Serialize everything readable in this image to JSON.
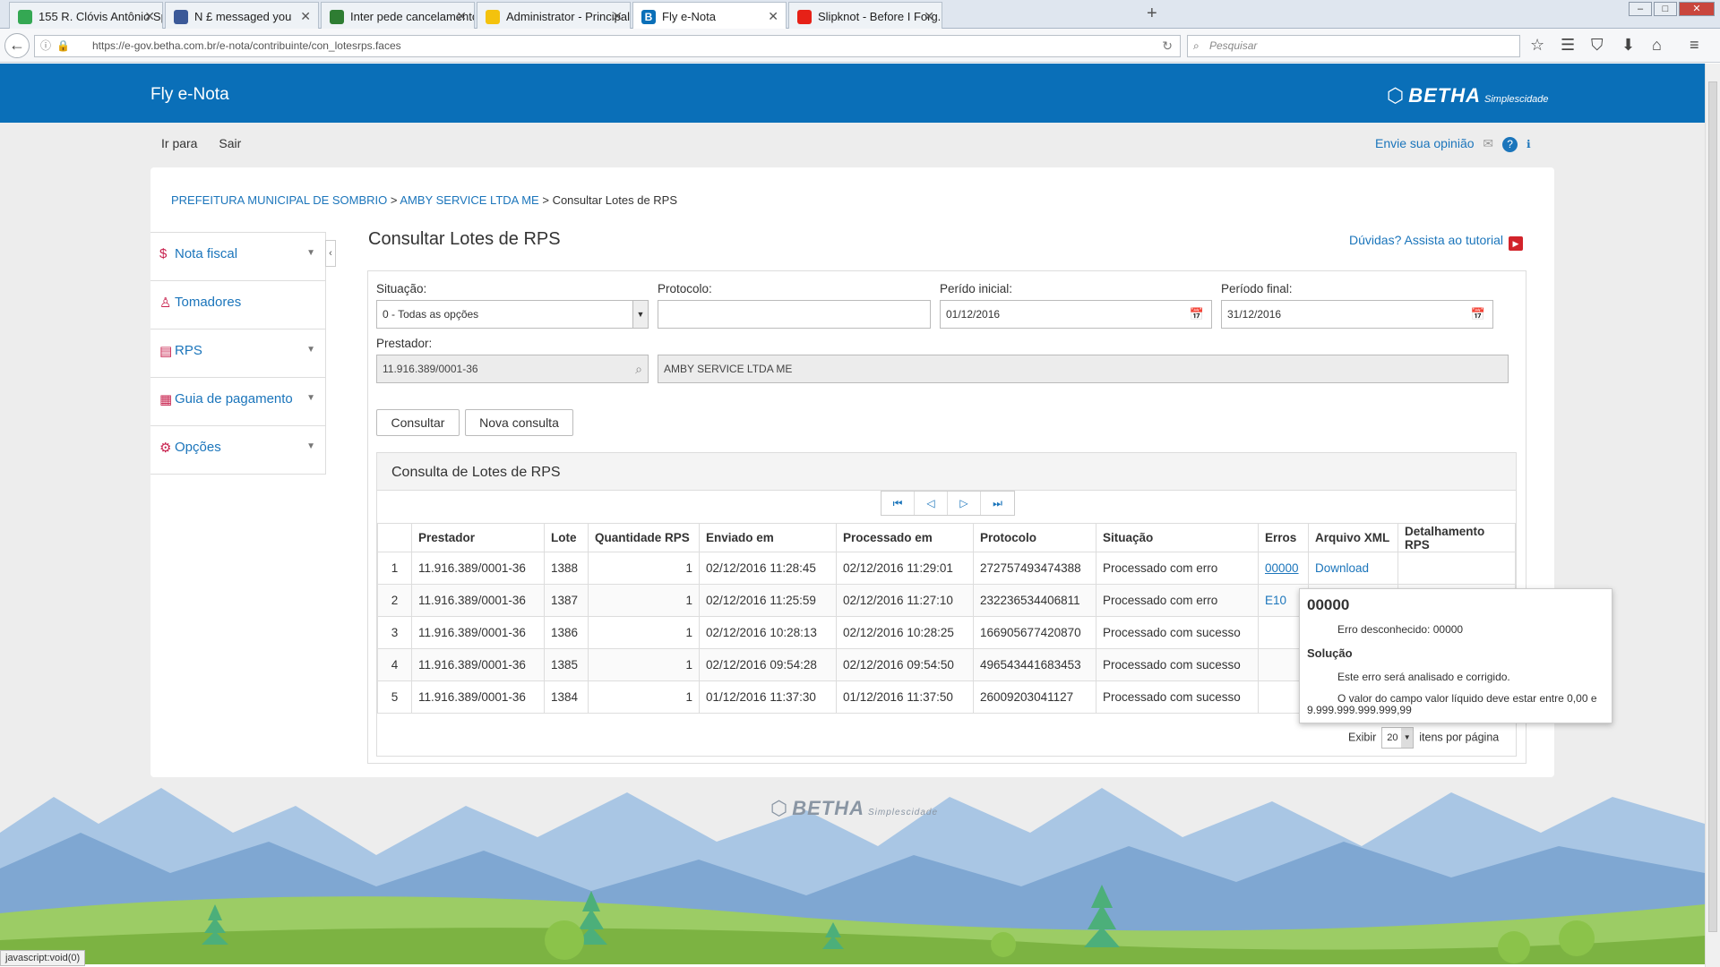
{
  "browser": {
    "tabs": [
      {
        "title": "155 R. Clóvis Antônio Sper...",
        "color": "#34a853"
      },
      {
        "title": "N £ messaged you",
        "color": "#3b5998"
      },
      {
        "title": "Inter pede cancelamento d...",
        "color": "#2e7d32"
      },
      {
        "title": "Administrator - Principal - ...",
        "color": "#f4c20d"
      },
      {
        "title": "Fly e-Nota",
        "color": "#0a6fb8"
      },
      {
        "title": "Slipknot - Before I Forg...",
        "color": "#e62117"
      }
    ],
    "url": "https://e-gov.betha.com.br/e-nota/contribuinte/con_lotesrps.faces",
    "search_placeholder": "Pesquisar",
    "status_text": "javascript:void(0)"
  },
  "header": {
    "app_title": "Fly e-Nota",
    "logo": "BETHA",
    "logo_sub": "Simplescidade"
  },
  "topnav": {
    "items": [
      "Ir para",
      "Sair"
    ],
    "feedback": "Envie sua opinião"
  },
  "breadcrumb": {
    "items": [
      "PREFEITURA MUNICIPAL DE SOMBRIO",
      "AMBY SERVICE LTDA ME"
    ],
    "current": "Consultar Lotes de RPS",
    "sep": ">"
  },
  "sidebar": {
    "items": [
      {
        "label": "Nota fiscal",
        "icon": "dollar-icon"
      },
      {
        "label": "Tomadores",
        "icon": "user-icon"
      },
      {
        "label": "RPS",
        "icon": "document-icon"
      },
      {
        "label": "Guia de pagamento",
        "icon": "calculator-icon"
      },
      {
        "label": "Opções",
        "icon": "gear-icon"
      }
    ]
  },
  "page": {
    "title": "Consultar Lotes de RPS",
    "tutorial": "Dúvidas? Assista ao tutorial"
  },
  "filters": {
    "situacao_label": "Situação:",
    "situacao_value": "0 - Todas as opções",
    "protocolo_label": "Protocolo:",
    "protocolo_value": "",
    "periodo_inicial_label": "Perído inicial:",
    "periodo_inicial_value": "01/12/2016",
    "periodo_final_label": "Período final:",
    "periodo_final_value": "31/12/2016",
    "prestador_label": "Prestador:",
    "prestador_cnpj": "11.916.389/0001-36",
    "prestador_nome": "AMBY SERVICE LTDA ME",
    "consultar_button": "Consultar",
    "nova_consulta_button": "Nova consulta"
  },
  "results": {
    "title": "Consulta de Lotes de RPS",
    "columns": [
      "",
      "Prestador",
      "Lote",
      "Quantidade RPS",
      "Enviado em",
      "Processado em",
      "Protocolo",
      "Situação",
      "Erros",
      "Arquivo XML",
      "Detalhamento RPS"
    ],
    "rows": [
      {
        "idx": "1",
        "prestador": "11.916.389/0001-36",
        "lote": "1388",
        "qtd": "1",
        "enviado": "02/12/2016 11:28:45",
        "processado": "02/12/2016 11:29:01",
        "protocolo": "272757493474388",
        "situacao": "Processado com erro",
        "erros": "00000",
        "xml": "Download"
      },
      {
        "idx": "2",
        "prestador": "11.916.389/0001-36",
        "lote": "1387",
        "qtd": "1",
        "enviado": "02/12/2016 11:25:59",
        "processado": "02/12/2016 11:27:10",
        "protocolo": "232236534406811",
        "situacao": "Processado com erro",
        "erros": "E10",
        "xml": ""
      },
      {
        "idx": "3",
        "prestador": "11.916.389/0001-36",
        "lote": "1386",
        "qtd": "1",
        "enviado": "02/12/2016 10:28:13",
        "processado": "02/12/2016 10:28:25",
        "protocolo": "166905677420870",
        "situacao": "Processado com sucesso",
        "erros": "",
        "xml": ""
      },
      {
        "idx": "4",
        "prestador": "11.916.389/0001-36",
        "lote": "1385",
        "qtd": "1",
        "enviado": "02/12/2016 09:54:28",
        "processado": "02/12/2016 09:54:50",
        "protocolo": "496543441683453",
        "situacao": "Processado com sucesso",
        "erros": "",
        "xml": ""
      },
      {
        "idx": "5",
        "prestador": "11.916.389/0001-36",
        "lote": "1384",
        "qtd": "1",
        "enviado": "01/12/2016 11:37:30",
        "processado": "01/12/2016 11:37:50",
        "protocolo": "26009203041127",
        "situacao": "Processado com sucesso",
        "erros": "",
        "xml": ""
      }
    ],
    "exibir_label": "Exibir",
    "per_page_value": "20",
    "per_page_suffix": "itens por página"
  },
  "tooltip": {
    "code": "00000",
    "error_text": "Erro desconhecido: 00000",
    "solution_heading": "Solução",
    "solution_text": "Este erro será analisado e corrigido.",
    "extra_text": "O valor do campo valor líquido deve estar entre 0,00 e 9.999.999.999.999,99"
  },
  "footer": {
    "logo": "BETHA",
    "logo_sub": "Simplescidade"
  },
  "colors": {
    "header_bg": "#0a6fb8",
    "link": "#1b75bb",
    "icon_accent": "#c8224e"
  }
}
